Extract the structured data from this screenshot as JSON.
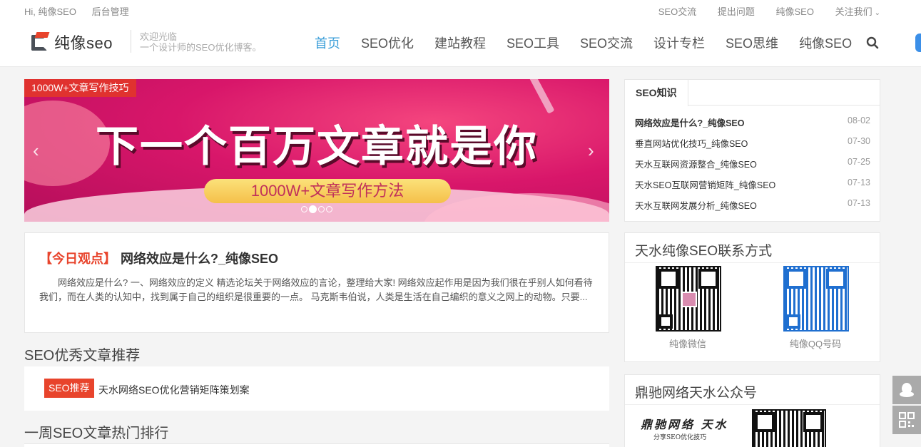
{
  "topbar": {
    "greeting": "Hi, 纯像SEO",
    "admin": "后台管理",
    "links": [
      "SEO交流",
      "提出问题",
      "纯像SEO",
      "关注我们"
    ]
  },
  "header": {
    "logo_text": "纯像seo",
    "slogan_1": "欢迎光临",
    "slogan_2": "一个设计师的SEO优化博客。",
    "nav": [
      "首页",
      "SEO优化",
      "建站教程",
      "SEO工具",
      "SEO交流",
      "设计专栏",
      "SEO思维",
      "纯像SEO"
    ],
    "active_nav": "首页"
  },
  "banner": {
    "tag": "1000W+文章写作技巧",
    "headline": "下一个百万文章就是你",
    "pill": "1000W+文章写作方法",
    "slide_count": 4,
    "active_slide": 2
  },
  "today": {
    "label": "【今日观点】",
    "title": "网络效应是什么?_纯像SEO",
    "excerpt": "网络效应是什么? 一、网络效应的定义 精选论坛关于网络效应的言论，整理给大家! 网络效应起作用是因为我们很在乎别人如何看待我们，而在人类的认知中，找到属于自己的组织是很重要的一点。 马克斯韦伯说，人类是生活在自己编织的意义之网上的动物。只要..."
  },
  "recommend": {
    "section_title": "SEO优秀文章推荐",
    "badge": "SEO推荐",
    "text": "天水网络SEO优化营销矩阵策划案"
  },
  "weekly": {
    "section_title": "一周SEO文章热门排行"
  },
  "sidebar": {
    "knowledge": {
      "tab": "SEO知识",
      "items": [
        {
          "title": "网络效应是什么?_纯像SEO",
          "date": "08-02"
        },
        {
          "title": "垂直网站优化技巧_纯像SEO",
          "date": "07-30"
        },
        {
          "title": "天水互联网资源整合_纯像SEO",
          "date": "07-25"
        },
        {
          "title": "天水SEO互联网营销矩阵_纯像SEO",
          "date": "07-13"
        },
        {
          "title": "天水互联网发展分析_纯像SEO",
          "date": "07-13"
        }
      ]
    },
    "contact": {
      "title": "天水纯像SEO联系方式",
      "wechat_label": "纯像微信",
      "qq_label": "纯像QQ号码"
    },
    "gzh": {
      "title": "鼎驰网络天水公众号",
      "brand": "鼎驰网络 天水",
      "brand_sub": "分享SEO优化技巧"
    }
  },
  "colors": {
    "accent": "#3c9fd9",
    "brand_red": "#e8442c",
    "banner_pink": "#d8166a"
  }
}
